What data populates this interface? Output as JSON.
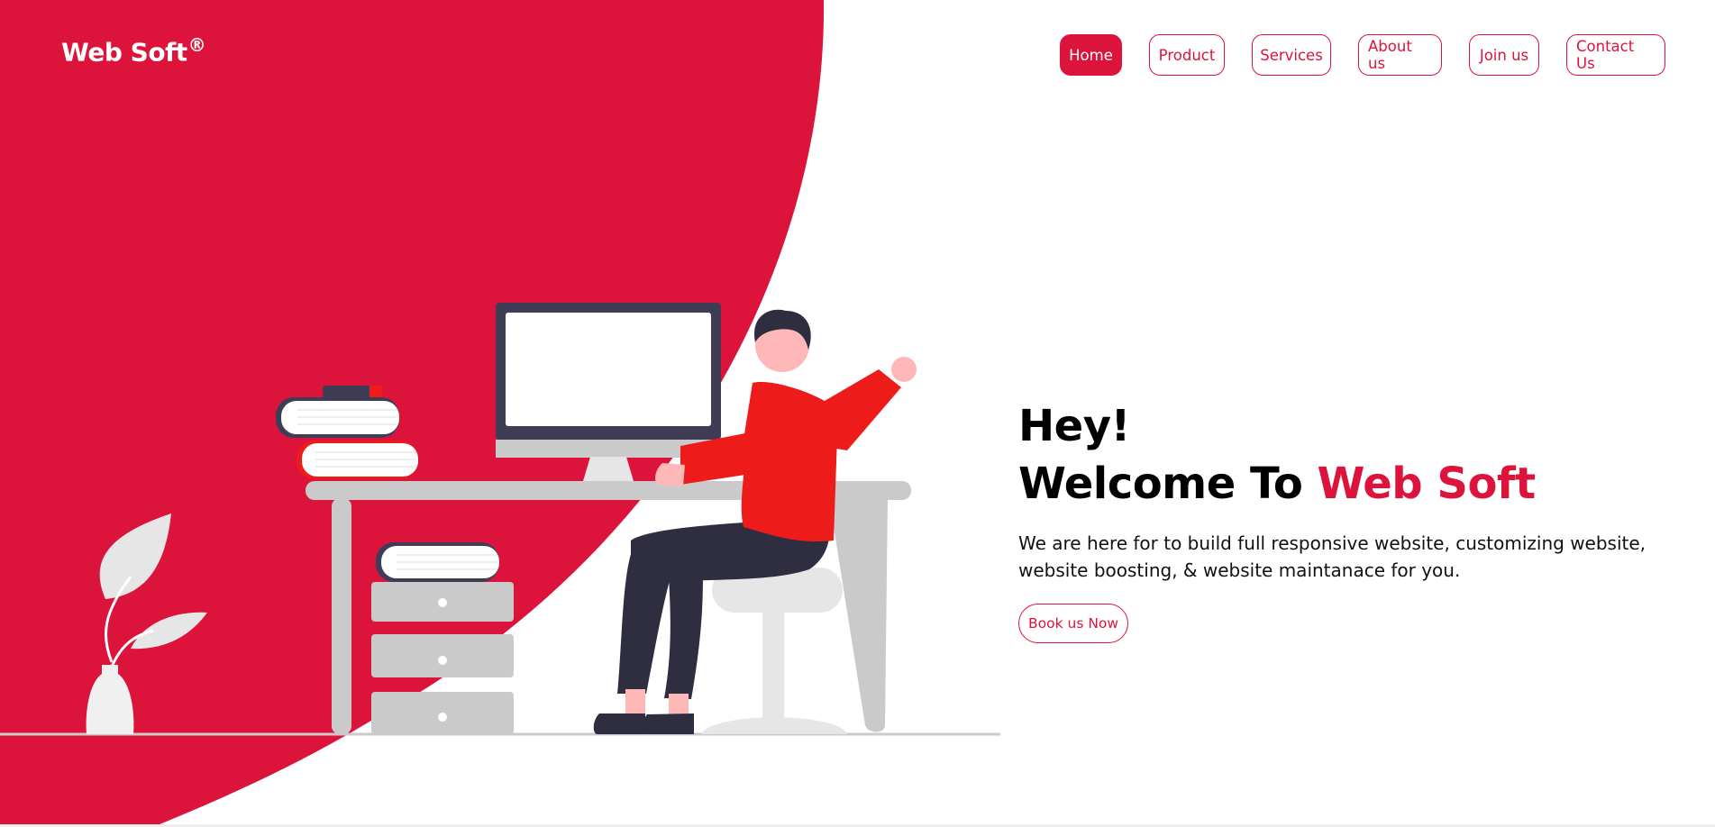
{
  "brand": {
    "name": "Web Soft",
    "mark": "®"
  },
  "nav": {
    "items": [
      {
        "label": "Home",
        "active": true
      },
      {
        "label": "Product",
        "active": false
      },
      {
        "label": "Services",
        "active": false
      },
      {
        "label": "About us",
        "active": false
      },
      {
        "label": "Join us",
        "active": false
      },
      {
        "label": "Contact Us",
        "active": false
      }
    ]
  },
  "hero": {
    "greeting": "Hey!",
    "welcome_prefix": "Welcome To ",
    "welcome_brand": "Web Soft",
    "description": "We are here for to build full responsive website, customizing website, website boosting, & website maintanace for you.",
    "cta_label": "Book us Now"
  },
  "colors": {
    "accent": "#dc143c",
    "shirt": "#ee1b1b",
    "dark": "#2f2e41",
    "light_gray": "#cacaca",
    "background": "#ffffff"
  }
}
